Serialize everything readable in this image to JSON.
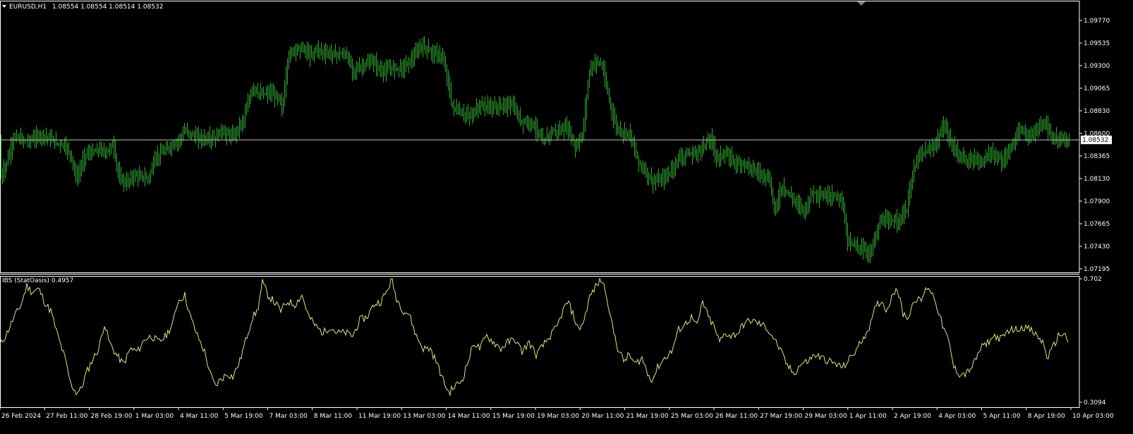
{
  "colors": {
    "background": "#000000",
    "foreground": "#ffffff",
    "candle": "#2eaa2e",
    "ibs_line": "#e8e07a",
    "price_line": "#c0c0c0",
    "separator": "#ffffff"
  },
  "header": {
    "menu_icon": "triangle-down-icon",
    "symbol": "EURUSD,H1",
    "ohlc": "1.08554 1.08554 1.08514 1.08532"
  },
  "indicator_header": "IBS (StatOasis) 0.4957",
  "current_price_label": "1.08532",
  "chart_data": [
    {
      "type": "candlestick",
      "symbol": "EURUSD",
      "timeframe": "H1",
      "ylim": [
        1.07195,
        1.0977
      ],
      "y_ticks": [
        "1.09770",
        "1.09535",
        "1.09300",
        "1.09065",
        "1.08830",
        "1.08600",
        "1.08365",
        "1.08130",
        "1.07900",
        "1.07665",
        "1.07430",
        "1.07195"
      ],
      "current_price": 1.08532,
      "grid": false,
      "x_ticks": [
        "26 Feb 2024",
        "27 Feb 11:00",
        "28 Feb 19:00",
        "1 Mar 03:00",
        "4 Mar 11:00",
        "5 Mar 19:00",
        "7 Mar 03:00",
        "8 Mar 11:00",
        "11 Mar 19:00",
        "13 Mar 03:00",
        "14 Mar 11:00",
        "15 Mar 19:00",
        "19 Mar 03:00",
        "20 Mar 11:00",
        "21 Mar 19:00",
        "25 Mar 03:00",
        "26 Mar 11:00",
        "27 Mar 19:00",
        "29 Mar 03:00",
        "1 Apr 11:00",
        "2 Apr 19:00",
        "4 Apr 03:00",
        "5 Apr 11:00",
        "8 Apr 19:00",
        "10 Apr 03:00"
      ],
      "close_path": [
        [
          0,
          1.0812
        ],
        [
          10,
          1.0832
        ],
        [
          20,
          1.0857
        ],
        [
          30,
          1.0853
        ],
        [
          40,
          1.0852
        ],
        [
          50,
          1.0856
        ],
        [
          60,
          1.0858
        ],
        [
          70,
          1.0855
        ],
        [
          80,
          1.085
        ],
        [
          90,
          1.0848
        ],
        [
          100,
          1.0838
        ],
        [
          108,
          1.0812
        ],
        [
          120,
          1.0838
        ],
        [
          130,
          1.084
        ],
        [
          140,
          1.0843
        ],
        [
          150,
          1.084
        ],
        [
          160,
          1.0849
        ],
        [
          168,
          1.0815
        ],
        [
          178,
          1.0808
        ],
        [
          190,
          1.0817
        ],
        [
          200,
          1.0815
        ],
        [
          210,
          1.0813
        ],
        [
          220,
          1.0835
        ],
        [
          235,
          1.0843
        ],
        [
          250,
          1.085
        ],
        [
          262,
          1.0863
        ],
        [
          275,
          1.0857
        ],
        [
          290,
          1.0854
        ],
        [
          305,
          1.0855
        ],
        [
          312,
          1.0863
        ],
        [
          320,
          1.0859
        ],
        [
          330,
          1.0857
        ],
        [
          345,
          1.0875
        ],
        [
          358,
          1.0908
        ],
        [
          368,
          1.09
        ],
        [
          382,
          1.0902
        ],
        [
          395,
          1.0897
        ],
        [
          400,
          1.0885
        ],
        [
          408,
          1.094
        ],
        [
          418,
          1.0948
        ],
        [
          430,
          1.0948
        ],
        [
          440,
          1.094
        ],
        [
          448,
          1.0948
        ],
        [
          460,
          1.0943
        ],
        [
          475,
          1.0942
        ],
        [
          490,
          1.0942
        ],
        [
          500,
          1.0925
        ],
        [
          515,
          1.093
        ],
        [
          528,
          1.0935
        ],
        [
          540,
          1.0924
        ],
        [
          555,
          1.0928
        ],
        [
          570,
          1.0928
        ],
        [
          585,
          1.0938
        ],
        [
          597,
          1.0951
        ],
        [
          610,
          1.0945
        ],
        [
          625,
          1.094
        ],
        [
          632,
          1.0925
        ],
        [
          640,
          1.0888
        ],
        [
          655,
          1.088
        ],
        [
          668,
          1.0878
        ],
        [
          680,
          1.089
        ],
        [
          695,
          1.0887
        ],
        [
          710,
          1.0888
        ],
        [
          725,
          1.089
        ],
        [
          738,
          1.0872
        ],
        [
          752,
          1.0872
        ],
        [
          762,
          1.0862
        ],
        [
          770,
          1.085
        ],
        [
          780,
          1.0862
        ],
        [
          790,
          1.0862
        ],
        [
          805,
          1.0866
        ],
        [
          815,
          1.0845
        ],
        [
          825,
          1.0858
        ],
        [
          835,
          1.0925
        ],
        [
          845,
          1.0935
        ],
        [
          853,
          1.093
        ],
        [
          862,
          1.0898
        ],
        [
          872,
          1.0868
        ],
        [
          882,
          1.086
        ],
        [
          892,
          1.0862
        ],
        [
          902,
          1.0835
        ],
        [
          912,
          1.0822
        ],
        [
          925,
          1.081
        ],
        [
          938,
          1.0812
        ],
        [
          950,
          1.082
        ],
        [
          962,
          1.0835
        ],
        [
          975,
          1.0838
        ],
        [
          988,
          1.084
        ],
        [
          1000,
          1.085
        ],
        [
          1008,
          1.0855
        ],
        [
          1015,
          1.0835
        ],
        [
          1025,
          1.0838
        ],
        [
          1035,
          1.0835
        ],
        [
          1045,
          1.0828
        ],
        [
          1055,
          1.083
        ],
        [
          1068,
          1.0822
        ],
        [
          1080,
          1.0818
        ],
        [
          1090,
          1.0812
        ],
        [
          1098,
          1.078
        ],
        [
          1108,
          1.0805
        ],
        [
          1120,
          1.0795
        ],
        [
          1132,
          1.0786
        ],
        [
          1142,
          1.078
        ],
        [
          1150,
          1.08
        ],
        [
          1162,
          1.0795
        ],
        [
          1175,
          1.0795
        ],
        [
          1188,
          1.0795
        ],
        [
          1196,
          1.0785
        ],
        [
          1200,
          1.0748
        ],
        [
          1210,
          1.0745
        ],
        [
          1222,
          1.074
        ],
        [
          1232,
          1.0735
        ],
        [
          1240,
          1.0752
        ],
        [
          1248,
          1.077
        ],
        [
          1260,
          1.0768
        ],
        [
          1272,
          1.077
        ],
        [
          1285,
          1.078
        ],
        [
          1292,
          1.0815
        ],
        [
          1302,
          1.0838
        ],
        [
          1315,
          1.0842
        ],
        [
          1325,
          1.0848
        ],
        [
          1338,
          1.0868
        ],
        [
          1348,
          1.085
        ],
        [
          1358,
          1.0838
        ],
        [
          1370,
          1.083
        ],
        [
          1380,
          1.0835
        ],
        [
          1392,
          1.083
        ],
        [
          1402,
          1.084
        ],
        [
          1412,
          1.0835
        ],
        [
          1422,
          1.083
        ],
        [
          1432,
          1.0845
        ],
        [
          1445,
          1.0862
        ],
        [
          1458,
          1.0858
        ],
        [
          1470,
          1.0862
        ],
        [
          1480,
          1.0872
        ],
        [
          1490,
          1.0855
        ],
        [
          1500,
          1.0855
        ],
        [
          1510,
          1.0853
        ],
        [
          1515,
          1.0853
        ]
      ]
    },
    {
      "type": "line",
      "name": "IBS (StatOasis)",
      "last_value": 0.4957,
      "ylim": [
        0.3094,
        0.702
      ],
      "y_ticks": [
        "0.702",
        "0.3094"
      ],
      "x_ticks": [
        "26 Feb 2024",
        "27 Feb 11:00",
        "28 Feb 19:00",
        "1 Mar 03:00",
        "4 Mar 11:00",
        "5 Mar 19:00",
        "7 Mar 03:00",
        "8 Mar 11:00",
        "11 Mar 19:00",
        "13 Mar 03:00",
        "14 Mar 11:00",
        "15 Mar 19:00",
        "19 Mar 03:00",
        "20 Mar 11:00",
        "21 Mar 19:00",
        "25 Mar 03:00",
        "26 Mar 11:00",
        "27 Mar 19:00",
        "29 Mar 03:00",
        "1 Apr 11:00",
        "2 Apr 19:00",
        "4 Apr 03:00",
        "5 Apr 11:00",
        "8 Apr 19:00",
        "10 Apr 03:00"
      ],
      "path": [
        [
          0,
          0.49
        ],
        [
          10,
          0.53
        ],
        [
          20,
          0.58
        ],
        [
          30,
          0.62
        ],
        [
          38,
          0.68
        ],
        [
          45,
          0.66
        ],
        [
          55,
          0.67
        ],
        [
          65,
          0.62
        ],
        [
          72,
          0.6
        ],
        [
          82,
          0.52
        ],
        [
          92,
          0.45
        ],
        [
          100,
          0.37
        ],
        [
          108,
          0.34
        ],
        [
          115,
          0.35
        ],
        [
          122,
          0.4
        ],
        [
          130,
          0.44
        ],
        [
          140,
          0.48
        ],
        [
          148,
          0.56
        ],
        [
          155,
          0.5
        ],
        [
          165,
          0.46
        ],
        [
          175,
          0.43
        ],
        [
          185,
          0.48
        ],
        [
          195,
          0.47
        ],
        [
          205,
          0.51
        ],
        [
          215,
          0.52
        ],
        [
          225,
          0.5
        ],
        [
          235,
          0.52
        ],
        [
          245,
          0.56
        ],
        [
          252,
          0.63
        ],
        [
          262,
          0.65
        ],
        [
          270,
          0.58
        ],
        [
          280,
          0.52
        ],
        [
          290,
          0.47
        ],
        [
          298,
          0.4
        ],
        [
          305,
          0.36
        ],
        [
          312,
          0.38
        ],
        [
          322,
          0.4
        ],
        [
          330,
          0.39
        ],
        [
          340,
          0.44
        ],
        [
          350,
          0.52
        ],
        [
          358,
          0.58
        ],
        [
          365,
          0.6
        ],
        [
          372,
          0.69
        ],
        [
          380,
          0.65
        ],
        [
          388,
          0.63
        ],
        [
          398,
          0.6
        ],
        [
          408,
          0.63
        ],
        [
          418,
          0.62
        ],
        [
          428,
          0.65
        ],
        [
          438,
          0.58
        ],
        [
          448,
          0.55
        ],
        [
          458,
          0.53
        ],
        [
          468,
          0.55
        ],
        [
          478,
          0.53
        ],
        [
          490,
          0.53
        ],
        [
          500,
          0.52
        ],
        [
          510,
          0.57
        ],
        [
          520,
          0.58
        ],
        [
          530,
          0.62
        ],
        [
          540,
          0.63
        ],
        [
          548,
          0.66
        ],
        [
          555,
          0.7
        ],
        [
          562,
          0.64
        ],
        [
          572,
          0.6
        ],
        [
          580,
          0.59
        ],
        [
          590,
          0.52
        ],
        [
          600,
          0.48
        ],
        [
          610,
          0.48
        ],
        [
          620,
          0.43
        ],
        [
          628,
          0.38
        ],
        [
          636,
          0.34
        ],
        [
          645,
          0.36
        ],
        [
          655,
          0.38
        ],
        [
          665,
          0.45
        ],
        [
          672,
          0.5
        ],
        [
          680,
          0.48
        ],
        [
          690,
          0.52
        ],
        [
          700,
          0.5
        ],
        [
          710,
          0.48
        ],
        [
          720,
          0.5
        ],
        [
          730,
          0.51
        ],
        [
          740,
          0.47
        ],
        [
          750,
          0.5
        ],
        [
          760,
          0.46
        ],
        [
          770,
          0.49
        ],
        [
          780,
          0.52
        ],
        [
          790,
          0.55
        ],
        [
          798,
          0.6
        ],
        [
          805,
          0.63
        ],
        [
          812,
          0.59
        ],
        [
          820,
          0.54
        ],
        [
          828,
          0.57
        ],
        [
          835,
          0.64
        ],
        [
          845,
          0.68
        ],
        [
          853,
          0.7
        ],
        [
          860,
          0.65
        ],
        [
          868,
          0.55
        ],
        [
          876,
          0.48
        ],
        [
          884,
          0.44
        ],
        [
          892,
          0.46
        ],
        [
          900,
          0.43
        ],
        [
          910,
          0.45
        ],
        [
          918,
          0.4
        ],
        [
          925,
          0.38
        ],
        [
          932,
          0.42
        ],
        [
          942,
          0.45
        ],
        [
          952,
          0.47
        ],
        [
          962,
          0.54
        ],
        [
          972,
          0.56
        ],
        [
          980,
          0.58
        ],
        [
          988,
          0.55
        ],
        [
          996,
          0.63
        ],
        [
          1004,
          0.58
        ],
        [
          1012,
          0.55
        ],
        [
          1020,
          0.5
        ],
        [
          1028,
          0.53
        ],
        [
          1036,
          0.52
        ],
        [
          1046,
          0.53
        ],
        [
          1055,
          0.56
        ],
        [
          1065,
          0.57
        ],
        [
          1075,
          0.56
        ],
        [
          1085,
          0.55
        ],
        [
          1095,
          0.52
        ],
        [
          1105,
          0.48
        ],
        [
          1115,
          0.43
        ],
        [
          1125,
          0.4
        ],
        [
          1135,
          0.43
        ],
        [
          1145,
          0.44
        ],
        [
          1155,
          0.46
        ],
        [
          1165,
          0.45
        ],
        [
          1175,
          0.44
        ],
        [
          1185,
          0.43
        ],
        [
          1195,
          0.42
        ],
        [
          1205,
          0.45
        ],
        [
          1215,
          0.48
        ],
        [
          1225,
          0.52
        ],
        [
          1235,
          0.56
        ],
        [
          1242,
          0.62
        ],
        [
          1250,
          0.63
        ],
        [
          1258,
          0.6
        ],
        [
          1265,
          0.66
        ],
        [
          1272,
          0.67
        ],
        [
          1280,
          0.59
        ],
        [
          1288,
          0.58
        ],
        [
          1296,
          0.64
        ],
        [
          1305,
          0.63
        ],
        [
          1315,
          0.68
        ],
        [
          1325,
          0.64
        ],
        [
          1335,
          0.56
        ],
        [
          1345,
          0.5
        ],
        [
          1352,
          0.42
        ],
        [
          1360,
          0.4
        ],
        [
          1370,
          0.4
        ],
        [
          1380,
          0.43
        ],
        [
          1390,
          0.48
        ],
        [
          1400,
          0.5
        ],
        [
          1410,
          0.52
        ],
        [
          1420,
          0.51
        ],
        [
          1430,
          0.54
        ],
        [
          1440,
          0.54
        ],
        [
          1450,
          0.55
        ],
        [
          1460,
          0.54
        ],
        [
          1470,
          0.52
        ],
        [
          1478,
          0.5
        ],
        [
          1485,
          0.45
        ],
        [
          1492,
          0.48
        ],
        [
          1500,
          0.52
        ],
        [
          1508,
          0.53
        ],
        [
          1515,
          0.5
        ]
      ]
    }
  ]
}
